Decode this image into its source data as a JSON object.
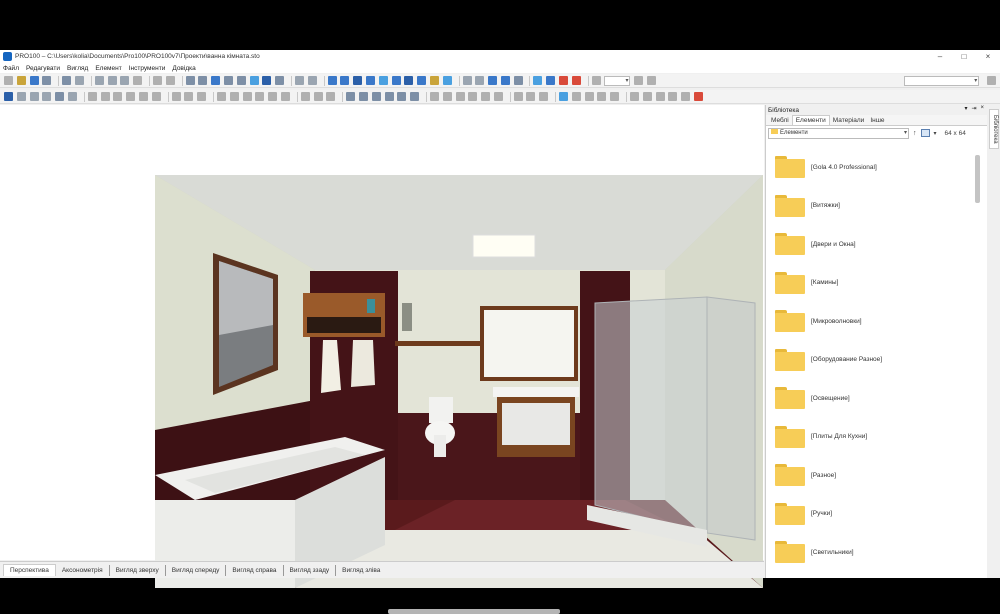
{
  "window": {
    "title": "PRO100 – C:\\Users\\kolia\\Documents\\Pro100\\PRO100v7\\Проекти\\ванна кімната.sto",
    "controls": {
      "minimize": "–",
      "maximize": "□",
      "close": "×"
    }
  },
  "menu": {
    "items": [
      "Файл",
      "Редагувати",
      "Вигляд",
      "Елемент",
      "Інструменти",
      "Довідка"
    ]
  },
  "toolbar": {
    "zoom_value": "",
    "right_combo": ""
  },
  "view_tabs": [
    "Перспектива",
    "Аксонометрія",
    "Вигляд зверху",
    "Вигляд спереду",
    "Вигляд справа",
    "Вигляд ззаду",
    "Вигляд зліва"
  ],
  "library": {
    "title": "Бібліотека",
    "header_buttons": [
      "▾",
      "⇥",
      "×"
    ],
    "tabs": [
      "Меблі",
      "Елементи",
      "Матеріали",
      "Інше"
    ],
    "active_tab": "Елементи",
    "path": "Елементи",
    "up_button": "↑",
    "grid_size": "64 x 64",
    "items": [
      "[Gola 4.0 Professional]",
      "[Витяжки]",
      "[Двери и Окна]",
      "[Камины]",
      "[Микроволновки]",
      "[Оборудование Разное]",
      "[Освещение]",
      "[Плиты Для Кухни]",
      "[Разное]",
      "[Ручки]",
      "[Светильники]"
    ]
  },
  "side_tab": "Бібліотека",
  "colors": {
    "wall": "#dcdfd0",
    "tile_dark": "#3d1114",
    "floor_light": "#e9e9e2",
    "folder": "#f7cd57"
  }
}
